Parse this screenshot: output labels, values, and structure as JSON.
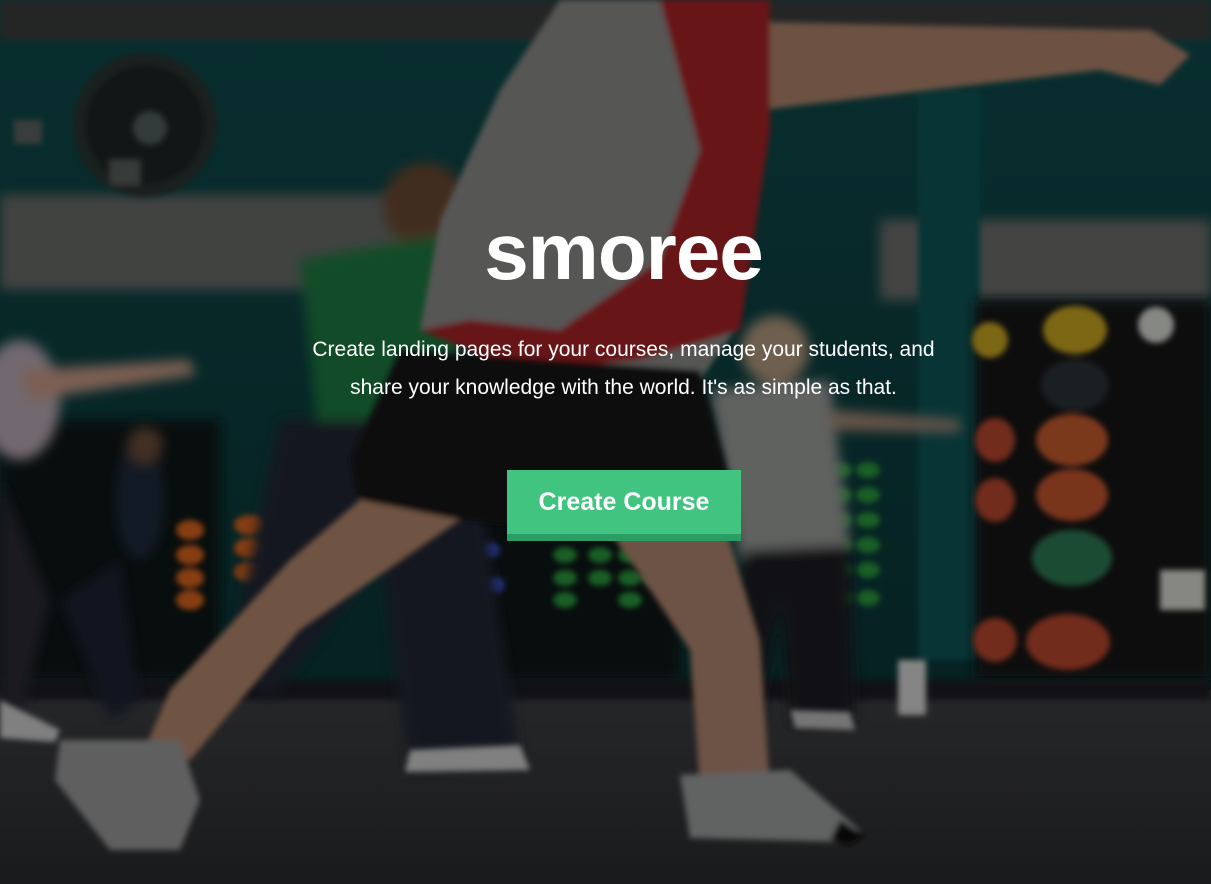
{
  "hero": {
    "brand": "smoree",
    "tagline_line1": "Create landing pages for your courses, manage your students, and",
    "tagline_line2": "share your knowledge with the world. It's as simple as that.",
    "cta_label": "Create Course"
  },
  "colors": {
    "cta_background": "#40c47f",
    "cta_shadow": "#2c9d62",
    "text": "#ffffff",
    "overlay": "rgba(0,0,0,0.38)"
  },
  "background_image": "gym-exercise-class-photo"
}
